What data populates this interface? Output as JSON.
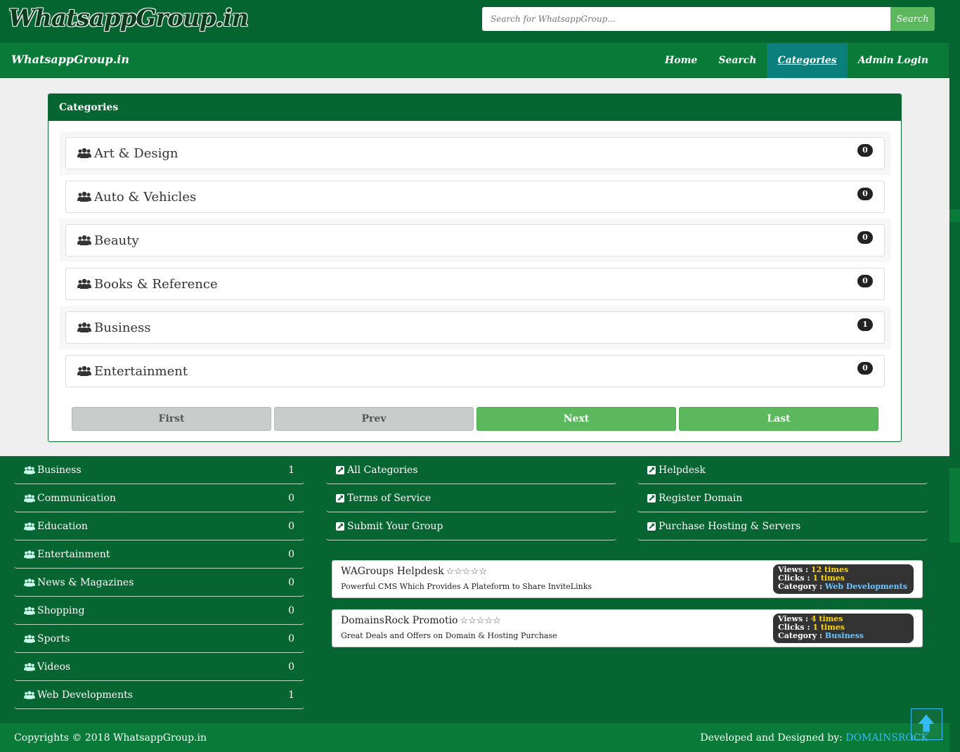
{
  "header": {
    "logo_text": "WhatsappGroup.in",
    "search_placeholder": "Search for WhatsappGroup...",
    "search_button": "Search"
  },
  "navbar": {
    "brand": "WhatsappGroup.in",
    "items": [
      {
        "label": "Home"
      },
      {
        "label": "Search"
      },
      {
        "label": "Categories"
      },
      {
        "label": "Admin Login"
      }
    ]
  },
  "panel": {
    "title": "Categories",
    "categories": [
      {
        "name": "Art & Design",
        "count": "0"
      },
      {
        "name": "Auto & Vehicles",
        "count": "0"
      },
      {
        "name": "Beauty",
        "count": "0"
      },
      {
        "name": "Books & Reference",
        "count": "0"
      },
      {
        "name": "Business",
        "count": "1"
      },
      {
        "name": "Entertainment",
        "count": "0"
      }
    ],
    "pager": {
      "first": "First",
      "prev": "Prev",
      "next": "Next",
      "last": "Last"
    }
  },
  "footer": {
    "category_counts": [
      {
        "name": "Business",
        "count": "1"
      },
      {
        "name": "Communication",
        "count": "0"
      },
      {
        "name": "Education",
        "count": "0"
      },
      {
        "name": "Entertainment",
        "count": "0"
      },
      {
        "name": "News & Magazines",
        "count": "0"
      },
      {
        "name": "Shopping",
        "count": "0"
      },
      {
        "name": "Sports",
        "count": "0"
      },
      {
        "name": "Videos",
        "count": "0"
      },
      {
        "name": "Web Developments",
        "count": "1"
      }
    ],
    "links_mid": [
      "All Categories",
      "Terms of Service",
      "Submit Your Group"
    ],
    "links_right": [
      "Helpdesk",
      "Register Domain",
      "Purchase Hosting & Servers"
    ],
    "promos": [
      {
        "title": "WAGroups Helpdesk",
        "stars": "☆☆☆☆☆",
        "desc": "Powerful CMS Which Provides A Plateform to Share InviteLinks",
        "views_label": "Views :",
        "views": "12 times",
        "clicks_label": "Clicks :",
        "clicks": "1 times",
        "category_label": "Category :",
        "category": "Web Developments"
      },
      {
        "title": "DomainsRock Promotio",
        "stars": "☆☆☆☆☆",
        "desc": "Great Deals and Offers on Domain & Hosting Purchase",
        "views_label": "Views :",
        "views": "4 times",
        "clicks_label": "Clicks :",
        "clicks": "1 times",
        "category_label": "Category :",
        "category": "Business"
      }
    ]
  },
  "bottombar": {
    "copyright": "Copyrights © 2018 WhatsappGroup.in",
    "dev_label": "Developed and Designed by:",
    "dev_link": "DOMAINSROCK"
  },
  "colors": {
    "dark_green": "#066530",
    "nav_green": "#0a7a38",
    "active_teal": "#0b7f7b",
    "button_green": "#5cb85c"
  }
}
